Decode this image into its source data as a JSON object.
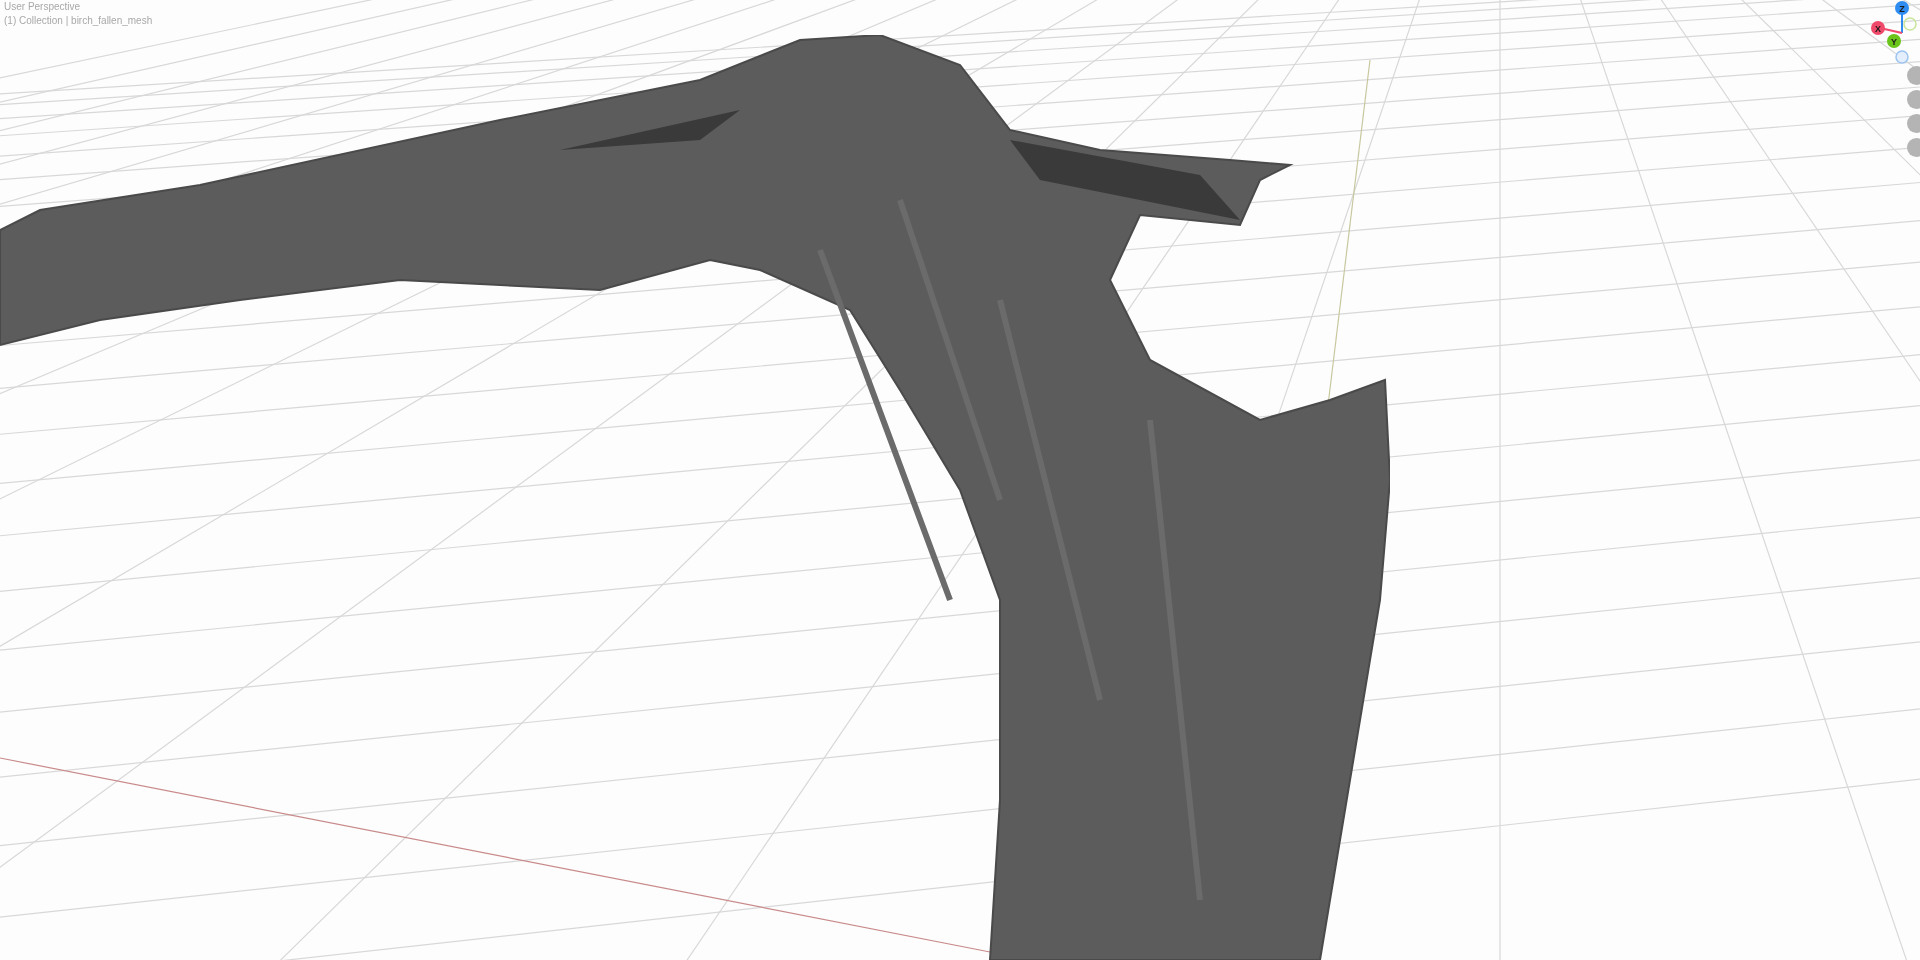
{
  "viewport": {
    "view_name": "User Perspective",
    "object_info": "(1) Collection | birch_fallen_mesh"
  },
  "gizmo": {
    "axes": [
      {
        "label": "Z",
        "color": "#2f8cf0"
      },
      {
        "label": "X",
        "color": "#f04a6a"
      },
      {
        "label": "Y",
        "color": "#6ac41a"
      }
    ]
  }
}
